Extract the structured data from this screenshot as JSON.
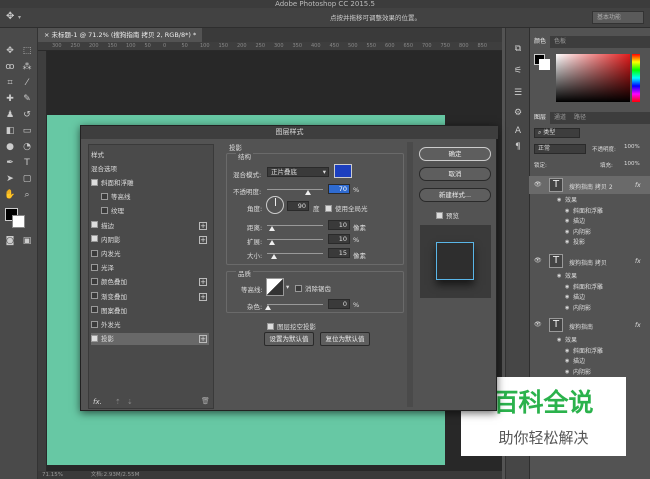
{
  "app_title": "Adobe Photoshop CC 2015.5",
  "options_hint": "点按并拖移可调整效果的位置。",
  "workspace": "基本功能",
  "doc_tab": "未标题-1 @ 71.2% (搜狗指南 拷贝 2, RGB/8*) *",
  "ruler_ticks": [
    "300",
    "250",
    "200",
    "150",
    "100",
    "50",
    "0",
    "50",
    "100",
    "150",
    "200",
    "250",
    "300",
    "350",
    "400",
    "450",
    "500",
    "550",
    "600",
    "650",
    "700",
    "750",
    "800",
    "850"
  ],
  "status": {
    "zoom": "71.15%",
    "doc": "文档:2.93M/2.55M"
  },
  "color_panel": {
    "tabs": [
      "颜色",
      "色板"
    ]
  },
  "layers_panel": {
    "tabs": [
      "图层",
      "通道",
      "路径"
    ],
    "kind": "类型",
    "blend": "正常",
    "opacity_label": "不透明度:",
    "opacity": "100%",
    "lock_label": "锁定:",
    "fill_label": "填充:",
    "fill": "100%",
    "layers": [
      {
        "name": "搜狗指南 拷贝 2",
        "fx": [
          "效果",
          "斜面和浮雕",
          "描边",
          "内阴影",
          "投影"
        ]
      },
      {
        "name": "搜狗指南 拷贝",
        "fx": [
          "效果",
          "斜面和浮雕",
          "描边",
          "内阴影"
        ]
      },
      {
        "name": "搜狗指南",
        "fx": [
          "效果",
          "斜面和浮雕",
          "描边",
          "内阴影"
        ]
      }
    ]
  },
  "dialog": {
    "title": "图层样式",
    "styles_header": "样式",
    "blend_options": "混合选项",
    "items": [
      {
        "label": "斜面和浮雕",
        "checked": true,
        "plus": false,
        "indent": false
      },
      {
        "label": "等高线",
        "checked": false,
        "plus": false,
        "indent": true
      },
      {
        "label": "纹理",
        "checked": false,
        "plus": false,
        "indent": true
      },
      {
        "label": "描边",
        "checked": true,
        "plus": true,
        "indent": false
      },
      {
        "label": "内阴影",
        "checked": true,
        "plus": true,
        "indent": false
      },
      {
        "label": "内发光",
        "checked": false,
        "plus": false,
        "indent": false
      },
      {
        "label": "光泽",
        "checked": false,
        "plus": false,
        "indent": false
      },
      {
        "label": "颜色叠加",
        "checked": false,
        "plus": true,
        "indent": false
      },
      {
        "label": "渐变叠加",
        "checked": false,
        "plus": true,
        "indent": false
      },
      {
        "label": "图案叠加",
        "checked": false,
        "plus": false,
        "indent": false
      },
      {
        "label": "外发光",
        "checked": false,
        "plus": false,
        "indent": false
      },
      {
        "label": "投影",
        "checked": true,
        "plus": true,
        "indent": false,
        "selected": true
      }
    ],
    "fx_label": "fx.",
    "section": "投影",
    "structure": "结构",
    "blend_mode_label": "混合模式:",
    "blend_mode": "正片叠底",
    "shadow_color": "#1c3fbf",
    "opacity_label": "不透明度:",
    "opacity": "70",
    "angle_label": "角度:",
    "angle": "90",
    "degree": "度",
    "global_light": "使用全局光",
    "distance_label": "距离:",
    "distance": "10",
    "spread_label": "扩展:",
    "spread": "10",
    "size_label": "大小:",
    "size": "15",
    "px": "像素",
    "pct": "%",
    "quality": "品质",
    "contour_label": "等高线:",
    "anti_alias": "消除锯齿",
    "noise_label": "杂色:",
    "noise": "0",
    "knockout": "图层挖空投影",
    "make_default": "设置为默认值",
    "reset_default": "复位为默认值",
    "ok": "确定",
    "cancel": "取消",
    "new_style": "新建样式...",
    "preview": "预览"
  },
  "watermark": {
    "title": "百科全说",
    "subtitle": "助你轻松解决"
  }
}
